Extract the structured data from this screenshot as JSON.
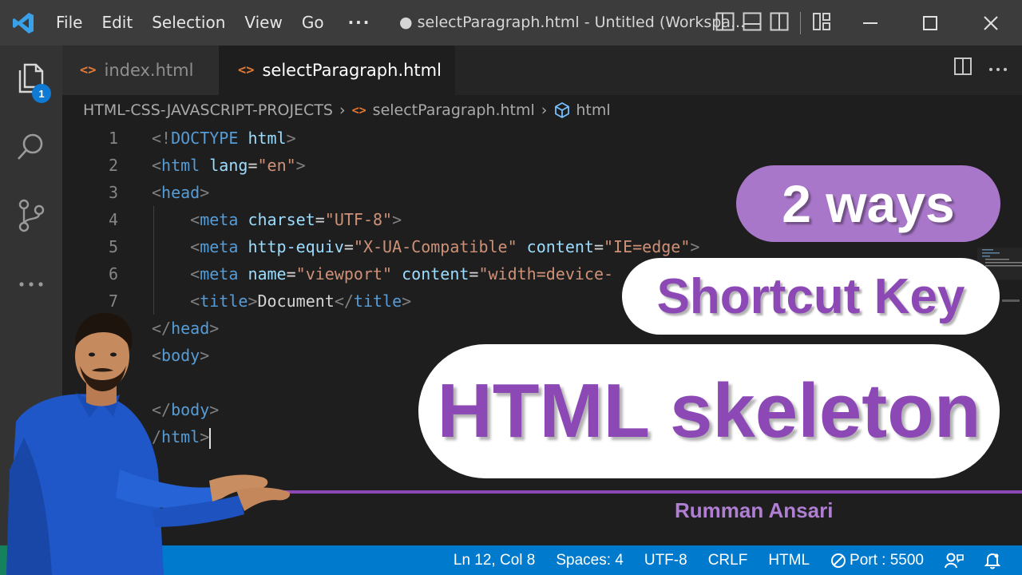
{
  "titlebar": {
    "menu": [
      "File",
      "Edit",
      "Selection",
      "View",
      "Go",
      "···"
    ],
    "window_title": "● selectParagraph.html - Untitled (Workspa..."
  },
  "activitybar": {
    "explorer_badge": "1",
    "items": [
      "explorer-icon",
      "search-icon",
      "source-control-icon",
      "more-icon"
    ]
  },
  "tabs": [
    {
      "label": "index.html",
      "active": false
    },
    {
      "label": "selectParagraph.html",
      "active": true,
      "dirty": true
    }
  ],
  "breadcrumb": {
    "folder": "HTML-CSS-JAVASCRIPT-PROJECTS",
    "file": "selectParagraph.html",
    "symbol": "html"
  },
  "editor": {
    "line_numbers": [
      "1",
      "2",
      "3",
      "4",
      "5",
      "6",
      "7"
    ],
    "lines": [
      [
        [
          "pun",
          "<!"
        ],
        [
          "tag",
          "DOCTYPE"
        ],
        [
          "txt",
          " "
        ],
        [
          "attr",
          "html"
        ],
        [
          "pun",
          ">"
        ]
      ],
      [
        [
          "pun",
          "<"
        ],
        [
          "tag",
          "html"
        ],
        [
          "txt",
          " "
        ],
        [
          "attr",
          "lang"
        ],
        [
          "txt",
          "="
        ],
        [
          "str",
          "\"en\""
        ],
        [
          "pun",
          ">"
        ]
      ],
      [
        [
          "pun",
          "<"
        ],
        [
          "tag",
          "head"
        ],
        [
          "pun",
          ">"
        ]
      ],
      [
        [
          "txt",
          "    "
        ],
        [
          "pun",
          "<"
        ],
        [
          "tag",
          "meta"
        ],
        [
          "txt",
          " "
        ],
        [
          "attr",
          "charset"
        ],
        [
          "txt",
          "="
        ],
        [
          "str",
          "\"UTF-8\""
        ],
        [
          "pun",
          ">"
        ]
      ],
      [
        [
          "txt",
          "    "
        ],
        [
          "pun",
          "<"
        ],
        [
          "tag",
          "meta"
        ],
        [
          "txt",
          " "
        ],
        [
          "attr",
          "http-equiv"
        ],
        [
          "txt",
          "="
        ],
        [
          "str",
          "\"X-UA-Compatible\""
        ],
        [
          "txt",
          " "
        ],
        [
          "attr",
          "content"
        ],
        [
          "txt",
          "="
        ],
        [
          "str",
          "\"IE=edge\""
        ],
        [
          "pun",
          ">"
        ]
      ],
      [
        [
          "txt",
          "    "
        ],
        [
          "pun",
          "<"
        ],
        [
          "tag",
          "meta"
        ],
        [
          "txt",
          " "
        ],
        [
          "attr",
          "name"
        ],
        [
          "txt",
          "="
        ],
        [
          "str",
          "\"viewport\""
        ],
        [
          "txt",
          " "
        ],
        [
          "attr",
          "content"
        ],
        [
          "txt",
          "="
        ],
        [
          "str",
          "\"width=device-"
        ]
      ],
      [
        [
          "txt",
          "    "
        ],
        [
          "pun",
          "<"
        ],
        [
          "tag",
          "title"
        ],
        [
          "pun",
          ">"
        ],
        [
          "txt",
          "Document"
        ],
        [
          "pun",
          "</"
        ],
        [
          "tag",
          "title"
        ],
        [
          "pun",
          ">"
        ]
      ],
      [
        [
          "pun",
          "</"
        ],
        [
          "tag",
          "head"
        ],
        [
          "pun",
          ">"
        ]
      ],
      [
        [
          "pun",
          "<"
        ],
        [
          "tag",
          "body"
        ],
        [
          "pun",
          ">"
        ]
      ],
      [],
      [
        [
          "pun",
          "</"
        ],
        [
          "tag",
          "body"
        ],
        [
          "pun",
          ">"
        ]
      ],
      [
        [
          "pun",
          "/"
        ],
        [
          "tag",
          "html"
        ],
        [
          "pun",
          ">"
        ]
      ]
    ]
  },
  "statusbar": {
    "position": "Ln 12, Col 8",
    "spaces": "Spaces: 4",
    "encoding": "UTF-8",
    "eol": "CRLF",
    "language": "HTML",
    "port": "Port : 5500"
  },
  "overlay": {
    "ways": "2 ways",
    "shortcut": "Shortcut Key",
    "skeleton": "HTML skeleton",
    "author": "Rumman Ansari"
  },
  "colors": {
    "accent_purple": "#8c49b5",
    "pill_purple": "#a977c9",
    "statusbar_blue": "#007acc"
  }
}
